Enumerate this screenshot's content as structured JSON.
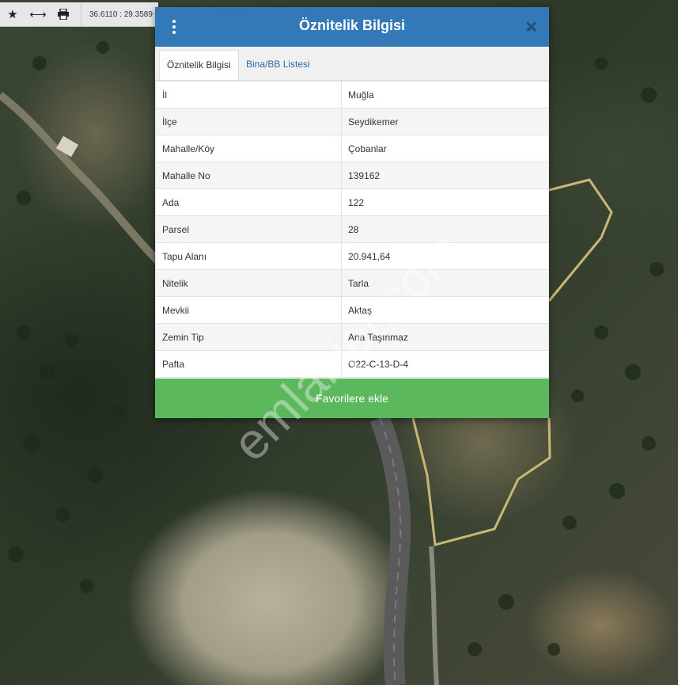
{
  "toolbar": {
    "coordinates": "36.6110 : 29.3589"
  },
  "dialog": {
    "title": "Öznitelik Bilgisi",
    "tabs": [
      {
        "label": "Öznitelik Bilgisi",
        "active": true
      },
      {
        "label": "Bina/BB Listesi",
        "active": false
      }
    ],
    "rows": [
      {
        "key": "İl",
        "value": "Muğla"
      },
      {
        "key": "İlçe",
        "value": "Seydikemer"
      },
      {
        "key": "Mahalle/Köy",
        "value": "Çobanlar"
      },
      {
        "key": "Mahalle No",
        "value": "139162"
      },
      {
        "key": "Ada",
        "value": "122"
      },
      {
        "key": "Parsel",
        "value": "28"
      },
      {
        "key": "Tapu Alanı",
        "value": "20.941,64"
      },
      {
        "key": "Nitelik",
        "value": "Tarla"
      },
      {
        "key": "Mevkii",
        "value": "Aktaş"
      },
      {
        "key": "Zemin Tip",
        "value": "Ana Taşınmaz"
      },
      {
        "key": "Pafta",
        "value": "O22-C-13-D-4"
      }
    ],
    "favorite_button": "Favorilere ekle"
  },
  "watermark": "emlakjet.com",
  "colors": {
    "header": "#3479b7",
    "favorite": "#5cb85c",
    "parcel_outline": "#c8b874"
  }
}
